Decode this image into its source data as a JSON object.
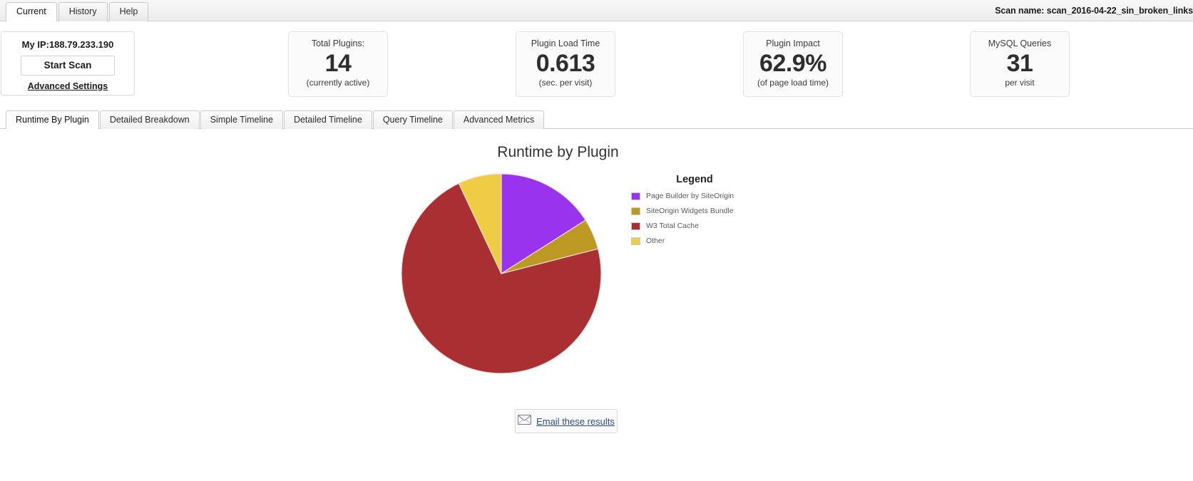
{
  "header": {
    "tabs": [
      {
        "label": "Current",
        "active": true
      },
      {
        "label": "History",
        "active": false
      },
      {
        "label": "Help",
        "active": false
      }
    ],
    "scan_name": "Scan name: scan_2016-04-22_sin_broken_links"
  },
  "ip_card": {
    "ip_text": "My IP:188.79.233.190",
    "start_scan_label": "Start  Scan",
    "advanced_settings_label": "Advanced Settings"
  },
  "stats": [
    {
      "title": "Total Plugins:",
      "value": "14",
      "sub": "(currently active)"
    },
    {
      "title": "Plugin Load Time",
      "value": "0.613",
      "sub": "(sec. per visit)"
    },
    {
      "title": "Plugin Impact",
      "value": "62.9%",
      "sub": "(of page load time)"
    },
    {
      "title": "MySQL Queries",
      "value": "31",
      "sub": "per visit"
    }
  ],
  "sub_tabs": [
    {
      "label": "Runtime By Plugin",
      "active": true
    },
    {
      "label": "Detailed Breakdown",
      "active": false
    },
    {
      "label": "Simple Timeline",
      "active": false
    },
    {
      "label": "Detailed Timeline",
      "active": false
    },
    {
      "label": "Query Timeline",
      "active": false
    },
    {
      "label": "Advanced Metrics",
      "active": false
    }
  ],
  "legend": {
    "title": "Legend"
  },
  "footer": {
    "email_link_label": "Email these results",
    "email_icon": "envelope-icon"
  },
  "chart_data": {
    "type": "pie",
    "title": "Runtime by Plugin",
    "labels": [
      "Page Builder by SiteOrigin",
      "SiteOrigin Widgets Bundle",
      "W3 Total Cache",
      "Other"
    ],
    "values": [
      16.0,
      5.0,
      72.0,
      7.0
    ],
    "colors": [
      "#9933ee",
      "#bb9922",
      "#aa2f33",
      "#eecc44"
    ],
    "start_angle": 0,
    "direction": "clockwise",
    "legend_position": "right",
    "grid": false,
    "units": "percent of plugin runtime"
  }
}
